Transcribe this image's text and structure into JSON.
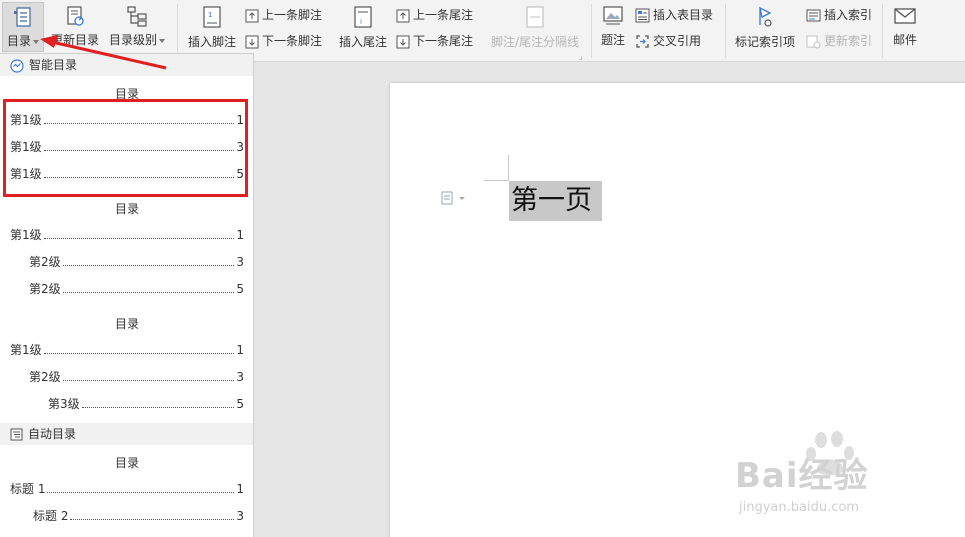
{
  "ribbon": {
    "toc": "目录",
    "update_toc": "更新目录",
    "toc_level": "目录级别",
    "insert_footnote": "插入脚注",
    "prev_footnote": "上一条脚注",
    "next_footnote": "下一条脚注",
    "insert_endnote": "插入尾注",
    "prev_endnote": "上一条尾注",
    "next_endnote": "下一条尾注",
    "separator_line": "脚注/尾注分隔线",
    "caption": "题注",
    "insert_table_of_figures": "插入表目录",
    "cross_reference": "交叉引用",
    "mark_index_entry": "标记索引项",
    "insert_index": "插入索引",
    "update_index": "更新索引",
    "mail": "邮件"
  },
  "panel": {
    "smart_toc": "智能目录",
    "auto_toc": "自动目录",
    "templates": [
      {
        "title": "目录",
        "lines": [
          {
            "label": "第1级",
            "page": "1"
          },
          {
            "label": "第1级",
            "page": "3"
          },
          {
            "label": "第1级",
            "page": "5"
          }
        ]
      },
      {
        "title": "目录",
        "lines": [
          {
            "label": "第1级",
            "page": "1"
          },
          {
            "label": "第2级",
            "page": "3"
          },
          {
            "label": "第2级",
            "page": "5"
          }
        ]
      },
      {
        "title": "目录",
        "lines": [
          {
            "label": "第1级",
            "page": "1"
          },
          {
            "label": "第2级",
            "page": "3"
          },
          {
            "label": "第3级",
            "page": "5"
          }
        ]
      }
    ],
    "auto_template": {
      "title": "目录",
      "lines": [
        {
          "label": "标题 1",
          "page": "1"
        },
        {
          "label": "标题 2",
          "page": "3"
        }
      ]
    }
  },
  "document": {
    "heading": "第一页"
  },
  "watermark": {
    "main": "Bai经验",
    "sub": "jingyan.baidu.com"
  },
  "colors": {
    "highlight": "#e02020",
    "arrow": "#e02020",
    "selection": "#c8c8c8"
  }
}
